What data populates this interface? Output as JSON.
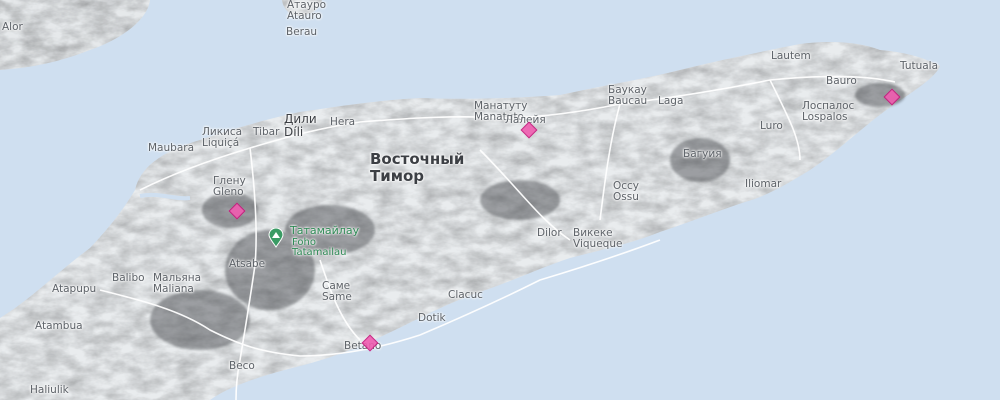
{
  "map": {
    "country_label": [
      "Восточный",
      "Тимор"
    ],
    "peak": {
      "label_ru": "Татамайлау",
      "label_local": [
        "Foho",
        "Tatamailau"
      ]
    },
    "places": [
      {
        "id": "alor",
        "lines": [
          "Alor"
        ]
      },
      {
        "id": "atauro",
        "lines": [
          "Атауро",
          "Atauro"
        ]
      },
      {
        "id": "berau",
        "lines": [
          "Berau"
        ]
      },
      {
        "id": "lautem",
        "lines": [
          "Lautem"
        ]
      },
      {
        "id": "tutuala",
        "lines": [
          "Tutuala"
        ]
      },
      {
        "id": "bauro",
        "lines": [
          "Bauro"
        ]
      },
      {
        "id": "baucau",
        "lines": [
          "Баукау",
          "Baucau"
        ]
      },
      {
        "id": "laga",
        "lines": [
          "Laga"
        ]
      },
      {
        "id": "lospalos",
        "lines": [
          "Лоспалос",
          "Lospalos"
        ]
      },
      {
        "id": "luro",
        "lines": [
          "Luro"
        ]
      },
      {
        "id": "manatuto",
        "lines": [
          "Манатуту",
          "Manatuto"
        ]
      },
      {
        "id": "laleia",
        "lines": [
          "Лалейя"
        ]
      },
      {
        "id": "dili",
        "lines": [
          "Дили",
          "Díli"
        ]
      },
      {
        "id": "hera",
        "lines": [
          "Hera"
        ]
      },
      {
        "id": "liquica",
        "lines": [
          "Ликиса",
          "Liquiçá"
        ]
      },
      {
        "id": "tibar",
        "lines": [
          "Tibar"
        ]
      },
      {
        "id": "maubara",
        "lines": [
          "Maubara"
        ]
      },
      {
        "id": "gleno",
        "lines": [
          "Глену",
          "Gleno"
        ]
      },
      {
        "id": "baguia",
        "lines": [
          "Багуия"
        ]
      },
      {
        "id": "iliomar",
        "lines": [
          "Iliomar"
        ]
      },
      {
        "id": "ossu",
        "lines": [
          "Оссу",
          "Ossu"
        ]
      },
      {
        "id": "viqueque",
        "lines": [
          "Викеке",
          "Viqueque"
        ]
      },
      {
        "id": "dilor",
        "lines": [
          "Dilor"
        ]
      },
      {
        "id": "clacuc",
        "lines": [
          "Clacuc"
        ]
      },
      {
        "id": "dotik",
        "lines": [
          "Dotik"
        ]
      },
      {
        "id": "same",
        "lines": [
          "Саме",
          "Same"
        ]
      },
      {
        "id": "atsabe",
        "lines": [
          "Atsabe"
        ]
      },
      {
        "id": "balibo",
        "lines": [
          "Balibo"
        ]
      },
      {
        "id": "maliana",
        "lines": [
          "Мальяна",
          "Maliana"
        ]
      },
      {
        "id": "atapupu",
        "lines": [
          "Atapupu"
        ]
      },
      {
        "id": "atambua",
        "lines": [
          "Atambua"
        ]
      },
      {
        "id": "betano",
        "lines": [
          "Betano"
        ]
      },
      {
        "id": "beco",
        "lines": [
          "Beco"
        ]
      },
      {
        "id": "haliulik",
        "lines": [
          "Haliulik"
        ]
      }
    ],
    "markers": [
      "gleno-marker",
      "laleia-marker",
      "tutuala-marker",
      "betano-marker"
    ],
    "colors": {
      "sea": "#cfdff0",
      "land": "#e9ecee",
      "marker": "#f05db0"
    }
  }
}
